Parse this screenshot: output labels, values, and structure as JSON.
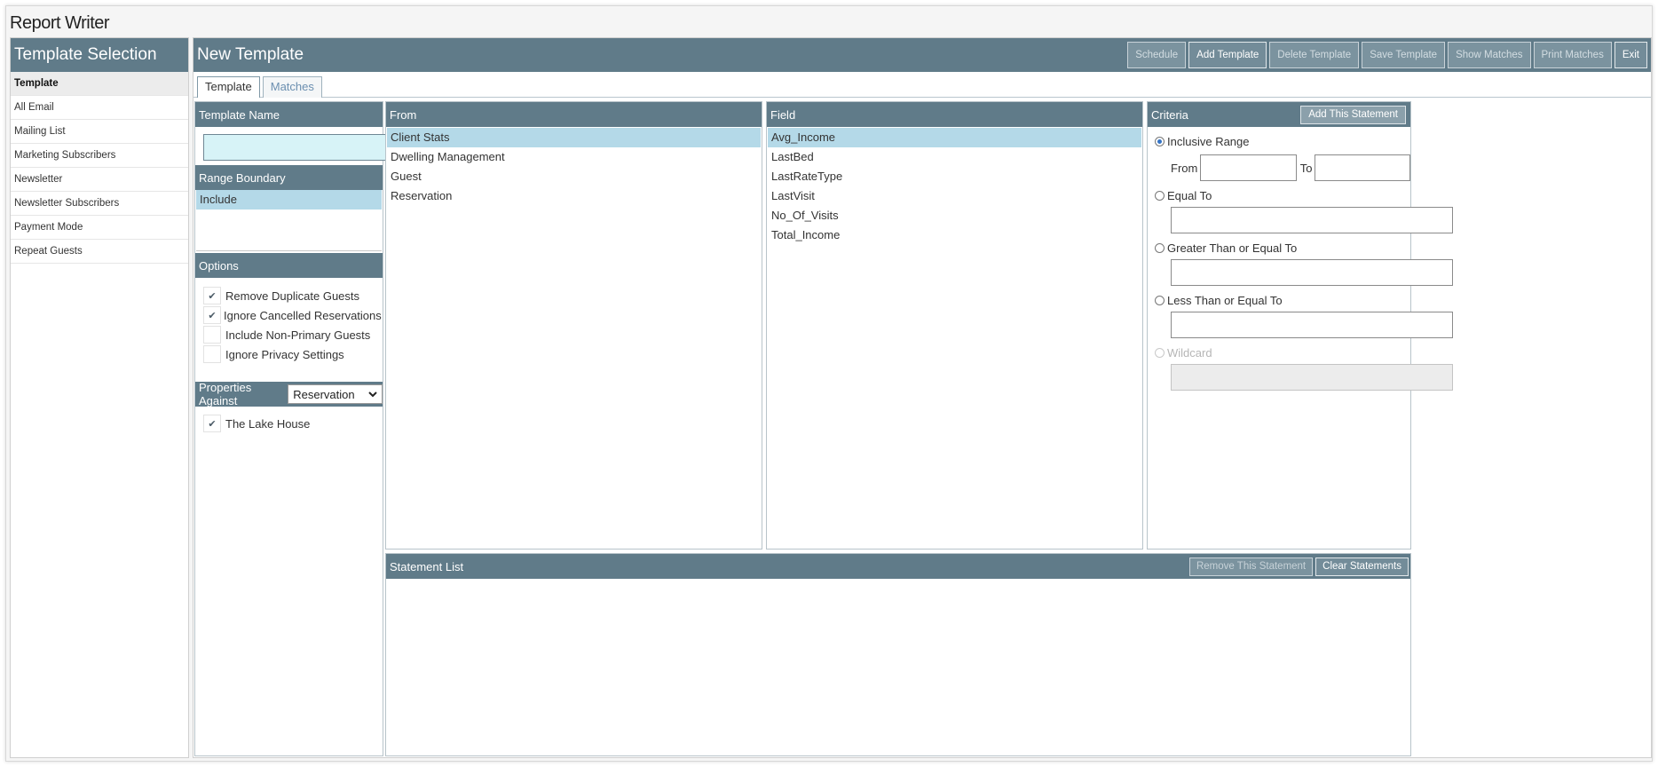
{
  "app": {
    "title": "Report Writer"
  },
  "sidebar": {
    "header": "Template Selection",
    "items": [
      {
        "label": "Template",
        "active": true
      },
      {
        "label": "All Email"
      },
      {
        "label": "Mailing List"
      },
      {
        "label": "Marketing Subscribers"
      },
      {
        "label": "Newsletter"
      },
      {
        "label": "Newsletter Subscribers"
      },
      {
        "label": "Payment Mode"
      },
      {
        "label": "Repeat Guests"
      }
    ]
  },
  "main": {
    "title": "New Template",
    "toolbar": {
      "schedule": "Schedule",
      "add_template": "Add Template",
      "delete_template": "Delete Template",
      "save_template": "Save Template",
      "show_matches": "Show Matches",
      "print_matches": "Print Matches",
      "exit": "Exit"
    },
    "tabs": [
      "Template",
      "Matches"
    ]
  },
  "template_name": {
    "header": "Template Name",
    "value": ""
  },
  "range_boundary": {
    "header": "Range Boundary",
    "items": [
      "Include"
    ]
  },
  "options": {
    "header": "Options",
    "items": [
      {
        "label": "Remove Duplicate Guests",
        "checked": true
      },
      {
        "label": "Ignore Cancelled Reservations",
        "checked": true
      },
      {
        "label": "Include Non-Primary Guests",
        "checked": false
      },
      {
        "label": "Ignore Privacy Settings",
        "checked": false
      }
    ]
  },
  "properties": {
    "header": "Properties Against",
    "selected": "Reservation",
    "items": [
      {
        "label": "The Lake House",
        "checked": true
      }
    ]
  },
  "from": {
    "header": "From",
    "items": [
      "Client Stats",
      "Dwelling Management",
      "Guest",
      "Reservation"
    ]
  },
  "field": {
    "header": "Field",
    "items": [
      "Avg_Income",
      "LastBed",
      "LastRateType",
      "LastVisit",
      "No_Of_Visits",
      "Total_Income"
    ]
  },
  "criteria": {
    "header": "Criteria",
    "add_button": "Add This Statement",
    "inclusive_range": "Inclusive Range",
    "from_label": "From",
    "to_label": "To",
    "equal_to": "Equal To",
    "gte": "Greater Than or Equal To",
    "lte": "Less Than or Equal To",
    "wildcard": "Wildcard"
  },
  "statement_list": {
    "header": "Statement List",
    "remove_button": "Remove This Statement",
    "clear_button": "Clear Statements"
  },
  "colors": {
    "header_bg": "#607b89",
    "selected_row": "#b4d9e8",
    "name_input_bg": "#d7f3f7"
  }
}
